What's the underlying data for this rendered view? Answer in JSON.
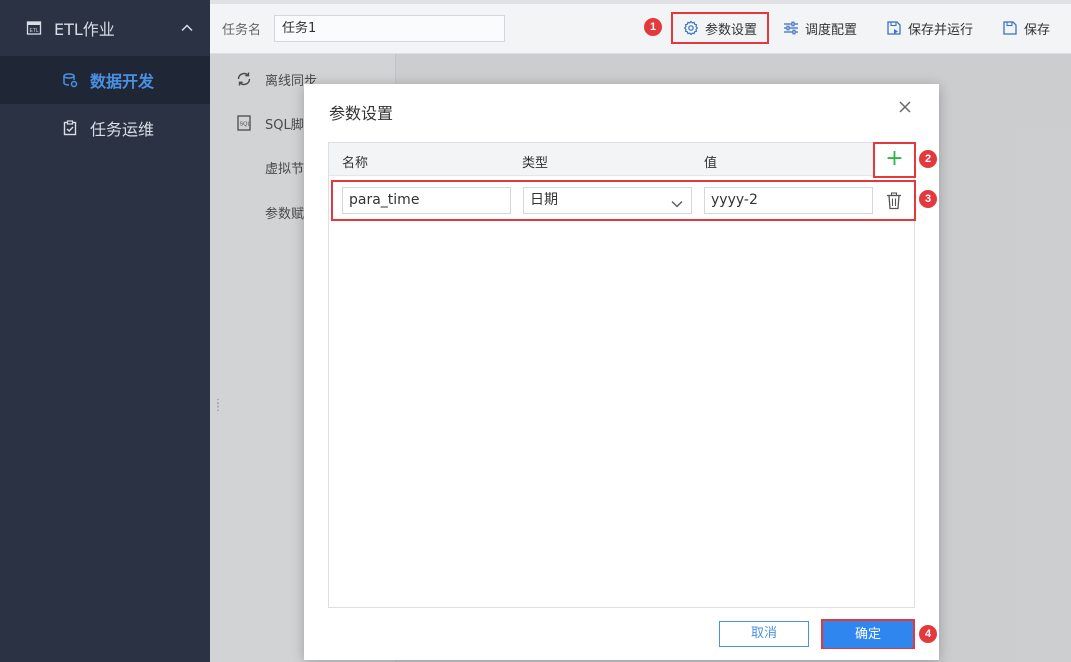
{
  "sidebar": {
    "group_label": "ETL作业",
    "items": [
      {
        "label": "数据开发",
        "active": true
      },
      {
        "label": "任务运维",
        "active": false
      }
    ]
  },
  "topbar": {
    "task_label": "任务名",
    "task_value": "任务1",
    "buttons": {
      "params": "参数设置",
      "schedule": "调度配置",
      "save_run": "保存并运行",
      "save": "保存"
    }
  },
  "tools": [
    {
      "label": "离线同步"
    },
    {
      "label": "SQL脚"
    },
    {
      "label": "虚拟节"
    },
    {
      "label": "参数赋"
    }
  ],
  "dialog": {
    "title": "参数设置",
    "columns": {
      "name": "名称",
      "type": "类型",
      "value": "值"
    },
    "add_symbol": "+",
    "rows": [
      {
        "name": "para_time",
        "type": "日期",
        "value": "yyyy-2"
      }
    ],
    "cancel": "取消",
    "ok": "确定"
  },
  "badges": [
    "1",
    "2",
    "3",
    "4"
  ],
  "colors": {
    "sidebar_bg": "#2a3244",
    "accent": "#2f86ef",
    "highlight": "#e4393c",
    "add_green": "#2fb54a"
  }
}
